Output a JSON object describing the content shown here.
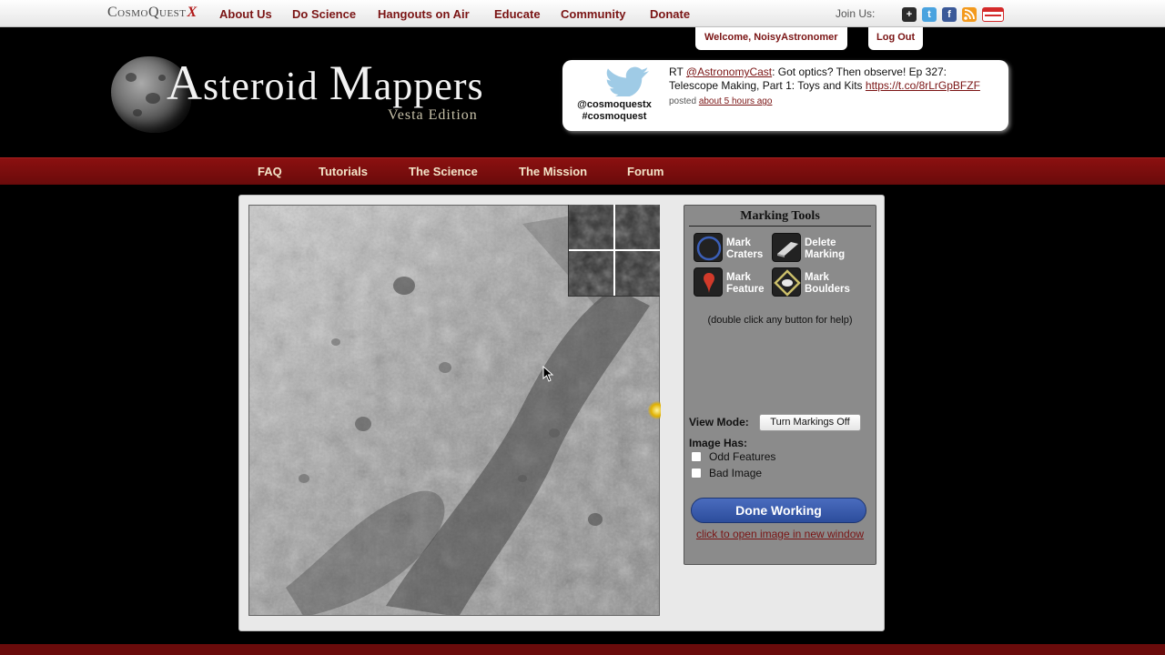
{
  "topnav": {
    "brand": "CosmoQuest",
    "brand_mark": "X",
    "links": [
      "About Us",
      "Do Science",
      "Hangouts on Air",
      "Educate",
      "Community",
      "Donate"
    ],
    "join_label": "Join Us:",
    "social": [
      {
        "name": "google-plus-icon",
        "glyph": "+",
        "color": "#2b2b2b"
      },
      {
        "name": "twitter-icon",
        "glyph": "t",
        "color": "#4aa3df"
      },
      {
        "name": "facebook-icon",
        "glyph": "f",
        "color": "#3b5998"
      },
      {
        "name": "rss-icon",
        "glyph": "",
        "color": "#f39a1d"
      },
      {
        "name": "meetup-icon",
        "glyph": "",
        "color": "#d42a2a"
      }
    ]
  },
  "session": {
    "welcome": "Welcome, NoisyAstronomer",
    "logout": "Log Out"
  },
  "header": {
    "title_first_letter": "A",
    "title_rest_1": "steroid ",
    "title_second_letter": "M",
    "title_rest_2": "appers",
    "subtitle": "Vesta Edition"
  },
  "twitter": {
    "handle": "@cosmoquestx",
    "hashtag": "#cosmoquest",
    "tweet_prefix": "RT ",
    "tweet_mention": "@AstronomyCast",
    "tweet_text": ": Got optics? Then observe! Ep 327: Telescope Making, Part 1: Toys and Kits ",
    "tweet_link": "https://t.co/8rLrGpBFZF",
    "posted": " posted ",
    "time": "about 5 hours ago"
  },
  "mainnav": [
    "FAQ",
    "Tutorials",
    "The Science",
    "The Mission",
    "Forum"
  ],
  "tools": {
    "title": "Marking Tools",
    "buttons": [
      {
        "line1": "Mark",
        "line2": "Craters"
      },
      {
        "line1": "Delete",
        "line2": "Marking"
      },
      {
        "line1": "Mark",
        "line2": "Feature"
      },
      {
        "line1": "Mark",
        "line2": "Boulders"
      }
    ],
    "hint": "(double click any button for help)",
    "view_mode_label": "View Mode:",
    "view_mode_button": "Turn Markings Off",
    "image_has_label": "Image Has:",
    "checkboxes": [
      "Odd Features",
      "Bad Image"
    ],
    "done_button": "Done Working",
    "open_link": "click to open image in new window"
  },
  "colors": {
    "accent_red": "#7a1414",
    "nav_red": "#6a0b0b",
    "done_blue": "#3a5cae"
  }
}
